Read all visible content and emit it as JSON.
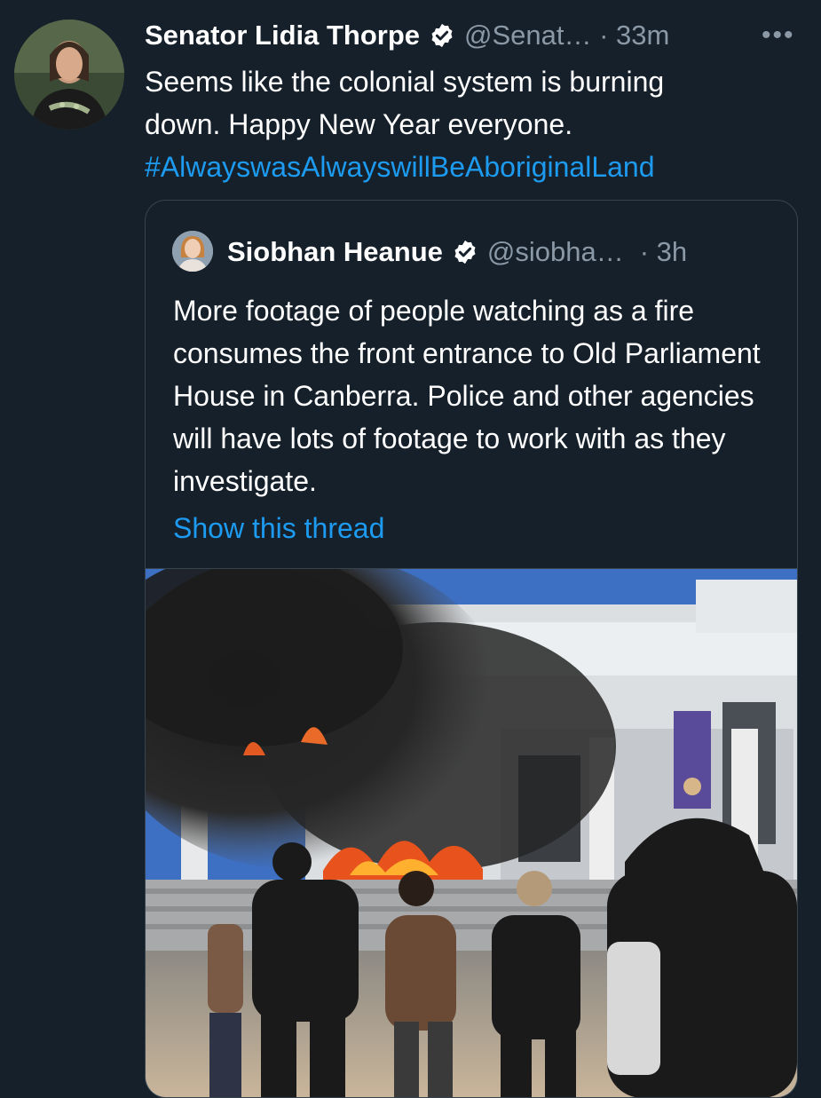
{
  "tweet": {
    "author_name": "Senator Lidia Thorpe",
    "handle_time": "@Senat… · 33m",
    "more_label": "•••",
    "text_line1": "Seems like the colonial system is burning",
    "text_line2": "down. Happy New Year everyone.",
    "hashtag": "#AlwayswasAlwayswillBeAboriginalLand",
    "verified_icon": "verified-badge-icon"
  },
  "quoted": {
    "author_name": "Siobhan Heanue",
    "handle": "@siobha…",
    "time": "· 3h",
    "text": "More footage of people watching as a fire consumes the front entrance to Old Parliament House in Canberra. Police and other agencies will have lots of footage to work with as they investigate.",
    "show_thread_label": "Show this thread",
    "media_description_icon": "video-thumbnail-icon"
  },
  "colors": {
    "background": "#15202b",
    "link": "#1d9bf0",
    "secondary_text": "#8b98a5",
    "border": "#38444d"
  }
}
